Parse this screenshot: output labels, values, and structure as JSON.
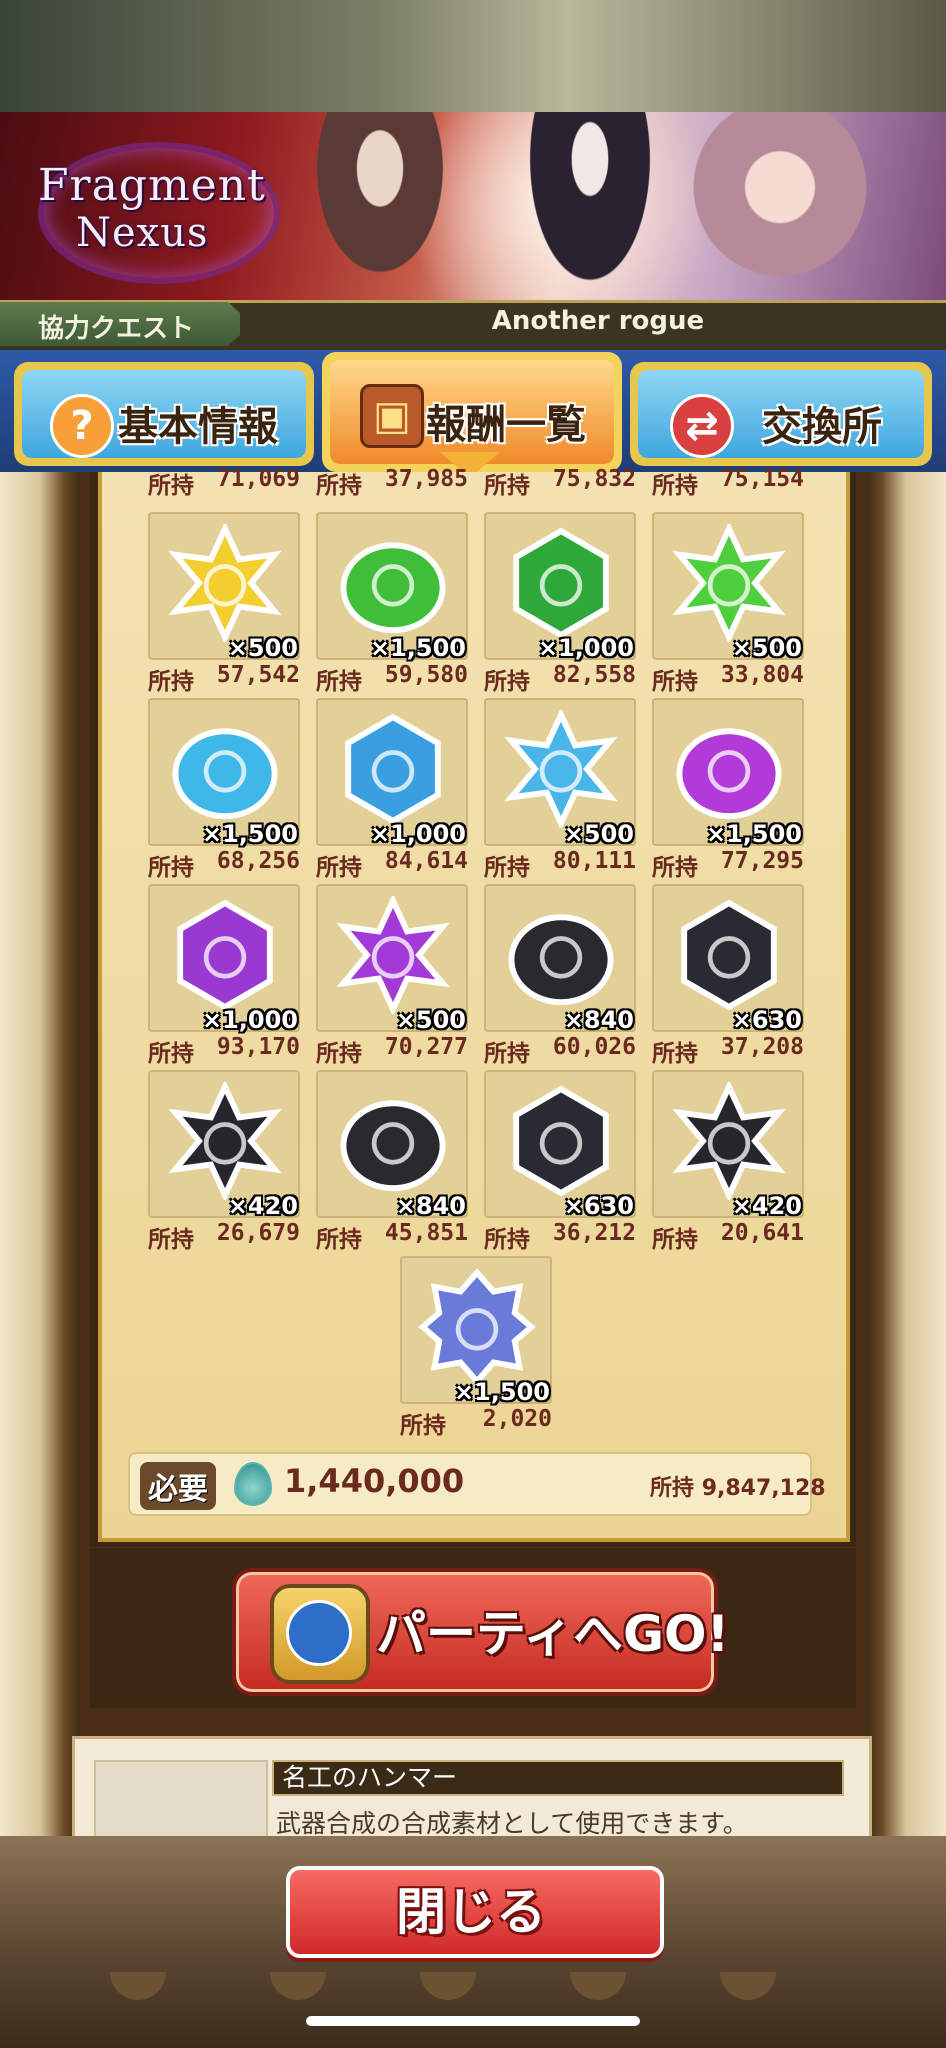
{
  "banner": {
    "logo_line1": "Fragment",
    "logo_line2": "Nexus"
  },
  "quest": {
    "type": "協力クエスト",
    "name": "Another rogue"
  },
  "tabs": [
    {
      "label": "基本情報",
      "icon": "question-icon"
    },
    {
      "label": "報酬一覧",
      "icon": "treasure-chest-icon",
      "active": true
    },
    {
      "label": "交換所",
      "icon": "exchange-icon"
    }
  ],
  "own_label": "所持",
  "top_row_owned": [
    "71,069",
    "37,985",
    "75,832",
    "75,154"
  ],
  "items": [
    {
      "shape": "star",
      "color": "#f2cf2e",
      "qty": "×500",
      "owned": "57,542"
    },
    {
      "shape": "blob",
      "color": "#3fbe3a",
      "qty": "×1,500",
      "owned": "59,580"
    },
    {
      "shape": "hex",
      "color": "#2fa83a",
      "qty": "×1,000",
      "owned": "82,558"
    },
    {
      "shape": "star",
      "color": "#4fcf3e",
      "qty": "×500",
      "owned": "33,804"
    },
    {
      "shape": "blob",
      "color": "#3fb7e8",
      "qty": "×1,500",
      "owned": "68,256"
    },
    {
      "shape": "hex",
      "color": "#3a9fe0",
      "qty": "×1,000",
      "owned": "84,614"
    },
    {
      "shape": "star",
      "color": "#4ab5e8",
      "qty": "×500",
      "owned": "80,111"
    },
    {
      "shape": "blob",
      "color": "#b23ad8",
      "qty": "×1,500",
      "owned": "77,295"
    },
    {
      "shape": "hex",
      "color": "#9a38d2",
      "qty": "×1,000",
      "owned": "93,170"
    },
    {
      "shape": "star",
      "color": "#a23ad8",
      "qty": "×500",
      "owned": "70,277"
    },
    {
      "shape": "blob",
      "color": "#2a2a2e",
      "qty": "×840",
      "owned": "60,026"
    },
    {
      "shape": "hex",
      "color": "#2a2a32",
      "qty": "×630",
      "owned": "37,208"
    },
    {
      "shape": "star",
      "color": "#26262c",
      "qty": "×420",
      "owned": "26,679"
    },
    {
      "shape": "blob",
      "color": "#2a2a2e",
      "qty": "×840",
      "owned": "45,851"
    },
    {
      "shape": "hex",
      "color": "#2a2a32",
      "qty": "×630",
      "owned": "36,212"
    },
    {
      "shape": "star",
      "color": "#26262c",
      "qty": "×420",
      "owned": "20,641"
    },
    {
      "shape": "medal",
      "color": "#6a7ad8",
      "qty": "×1,500",
      "owned": "2,020"
    }
  ],
  "required": {
    "label": "必要",
    "value": "1,440,000",
    "own_label": "所持",
    "own_value": "9,847,128"
  },
  "go_button": "パーティへGO!",
  "detail": {
    "title": "名工のハンマー",
    "text": "武器合成の合成素材として使用できます。"
  },
  "close_button": "閉じる"
}
